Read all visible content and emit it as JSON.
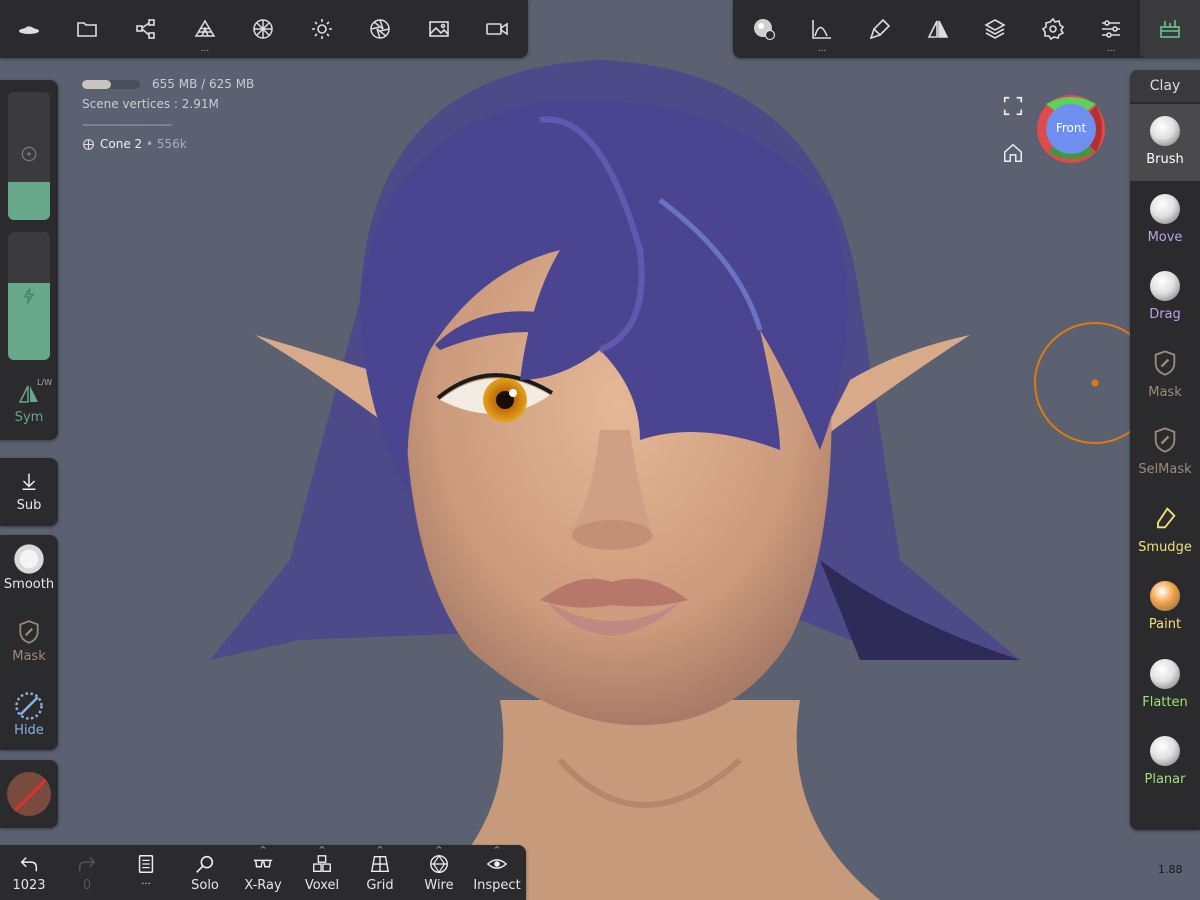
{
  "top_toolbar_left": [
    {
      "icon": "app-logo-icon"
    },
    {
      "icon": "folder-icon"
    },
    {
      "icon": "scene-tree-icon"
    },
    {
      "icon": "topology-icon",
      "more": "..."
    },
    {
      "icon": "material-sphere-icon"
    },
    {
      "icon": "light-icon"
    },
    {
      "icon": "camera-aperture-icon"
    },
    {
      "icon": "image-icon"
    },
    {
      "icon": "video-icon"
    }
  ],
  "top_toolbar_right": [
    {
      "icon": "brush-settings-icon"
    },
    {
      "icon": "stroke-curve-icon",
      "more": "..."
    },
    {
      "icon": "paint-dropper-icon"
    },
    {
      "icon": "symmetry-icon"
    },
    {
      "icon": "layers-icon"
    },
    {
      "icon": "settings-gear-icon"
    },
    {
      "icon": "sliders-icon",
      "more": "..."
    },
    {
      "icon": "toolbox-icon"
    }
  ],
  "info": {
    "memory": "655 MB / 625 MB",
    "memory_fraction": 0.5,
    "vertices": "Scene vertices : 2.91M",
    "separator": "------------------------------",
    "object": "Cone 2",
    "object_count": "• 556k"
  },
  "left_panel": {
    "radius_fraction": 0.3,
    "intensity_fraction": 0.6,
    "sym_label": "Sym",
    "sym_badge": "L/W",
    "sub_label": "Sub",
    "smooth_label": "Smooth",
    "mask_label": "Mask",
    "hide_label": "Hide"
  },
  "view_cube": {
    "label": "Front"
  },
  "right_tools": {
    "header": "Clay",
    "items": [
      {
        "label": "Brush",
        "color": "#ffffff"
      },
      {
        "label": "Move",
        "color": "#b6a6e6"
      },
      {
        "label": "Drag",
        "color": "#b6a6e6"
      },
      {
        "label": "Mask",
        "color": "#9c8a7a"
      },
      {
        "label": "SelMask",
        "color": "#9c8a7a"
      },
      {
        "label": "Smudge",
        "color": "#f0e07a"
      },
      {
        "label": "Paint",
        "color": "#f0e07a"
      },
      {
        "label": "Flatten",
        "color": "#9fe07a"
      },
      {
        "label": "Planar",
        "color": "#9fe07a"
      }
    ]
  },
  "bottom_toolbar": [
    {
      "icon": "undo-icon",
      "label": "1023"
    },
    {
      "icon": "redo-icon",
      "label": "0"
    },
    {
      "icon": "history-book-icon",
      "label": "..."
    },
    {
      "icon": "search-icon",
      "label": "Solo"
    },
    {
      "icon": "xray-glasses-icon",
      "label": "X-Ray"
    },
    {
      "icon": "voxel-cubes-icon",
      "label": "Voxel"
    },
    {
      "icon": "grid-icon",
      "label": "Grid"
    },
    {
      "icon": "wireframe-icon",
      "label": "Wire"
    },
    {
      "icon": "eye-icon",
      "label": "Inspect"
    }
  ],
  "fps": "1.88",
  "colors": {
    "panel": "#2b2b2d",
    "accent": "#67a88a",
    "viewport": "#5b6171",
    "brush_ring": "#e07a10"
  }
}
